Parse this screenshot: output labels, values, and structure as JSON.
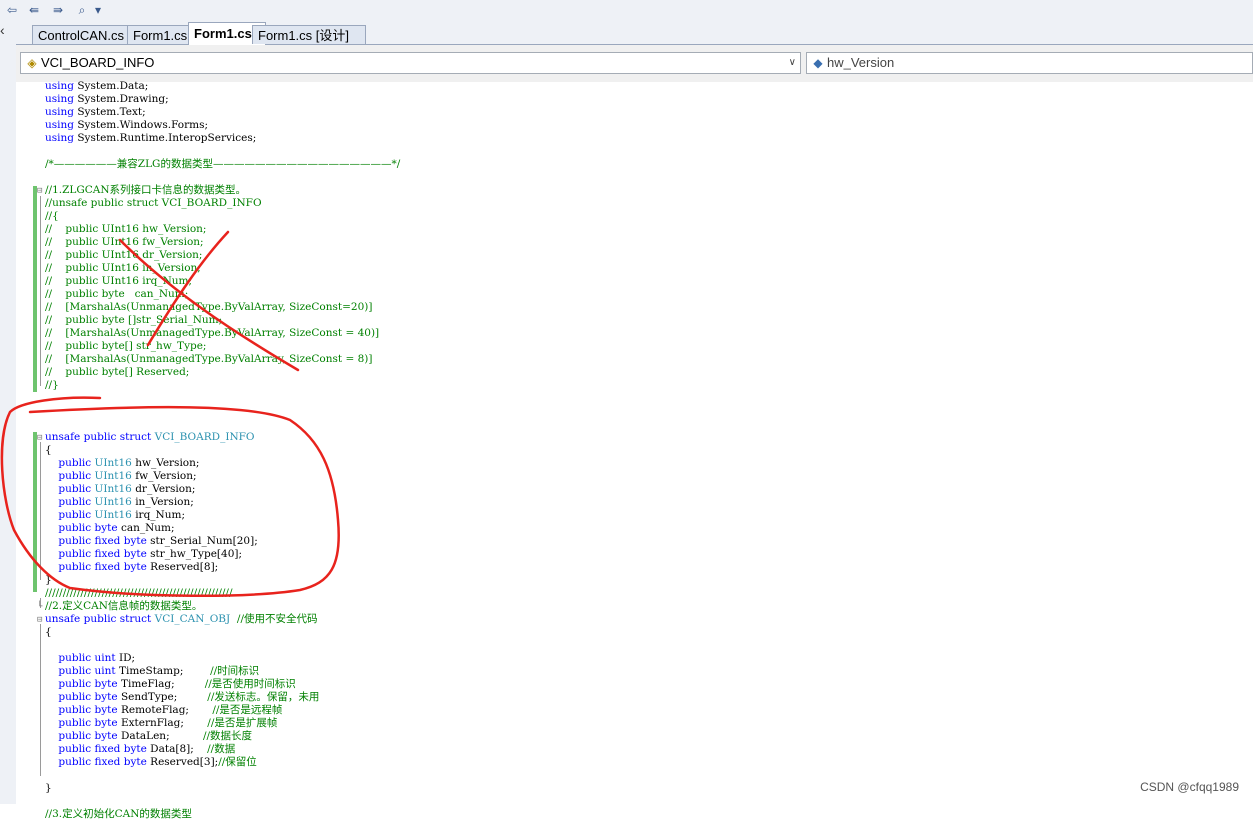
{
  "toolbar": {
    "icons": [
      "nav-back-icon",
      "nav-prev-bookmark-icon",
      "nav-next-bookmark-icon",
      "find-icon"
    ]
  },
  "tabs": [
    {
      "label": "ControlCAN.cs"
    },
    {
      "label": "Form1.cs"
    },
    {
      "label": "Form1.cs"
    },
    {
      "label": "Form1.cs [设计]"
    }
  ],
  "nav": {
    "type_combo": "VCI_BOARD_INFO",
    "member_combo": "hw_Version"
  },
  "code": {
    "lines": [
      "using System.Data;",
      "using System.Drawing;",
      "using System.Text;",
      "using System.Windows.Forms;",
      "using System.Runtime.InteropServices;",
      "",
      "/*——————兼容ZLG的数据类型—————————————————*/",
      "",
      "//1.ZLGCAN系列接口卡信息的数据类型。",
      "//unsafe public struct VCI_BOARD_INFO",
      "//{",
      "//    public UInt16 hw_Version;",
      "//    public UInt16 fw_Version;",
      "//    public UInt16 dr_Version;",
      "//    public UInt16 in_Version;",
      "//    public UInt16 irq_Num;",
      "//    public byte   can_Num;",
      "//    [MarshalAs(UnmanagedType.ByValArray, SizeConst=20)]",
      "//    public byte []str_Serial_Num;",
      "//    [MarshalAs(UnmanagedType.ByValArray, SizeConst = 40)]",
      "//    public byte[] str_hw_Type;",
      "//    [MarshalAs(UnmanagedType.ByValArray, SizeConst = 8)]",
      "//    public byte[] Reserved;",
      "//}",
      "",
      "",
      "",
      "unsafe public struct VCI_BOARD_INFO",
      "{",
      "    public UInt16 hw_Version;",
      "    public UInt16 fw_Version;",
      "    public UInt16 dr_Version;",
      "    public UInt16 in_Version;",
      "    public UInt16 irq_Num;",
      "    public byte can_Num;",
      "    public fixed byte str_Serial_Num[20];",
      "    public fixed byte str_hw_Type[40];",
      "    public fixed byte Reserved[8];",
      "}",
      "/////////////////////////////////////////////////////",
      "//2.定义CAN信息帧的数据类型。",
      "unsafe public struct VCI_CAN_OBJ  //使用不安全代码",
      "{",
      "",
      "    public uint ID;",
      "    public uint TimeStamp;        //时间标识",
      "    public byte TimeFlag;         //是否使用时间标识",
      "    public byte SendType;         //发送标志。保留，未用",
      "    public byte RemoteFlag;       //是否是远程帧",
      "    public byte ExternFlag;       //是否是扩展帧",
      "    public byte DataLen;          //数据长度",
      "    public fixed byte Data[8];    //数据",
      "    public fixed byte Reserved[3];//保留位",
      "",
      "}",
      "",
      "//3.定义初始化CAN的数据类型"
    ]
  },
  "watermark": "CSDN @cfqq1989",
  "colors": {
    "keyword": "#0000ff",
    "type": "#2b91af",
    "comment": "#008000",
    "annotation": "#e8231d",
    "changed_bar": "#6ec46e"
  }
}
